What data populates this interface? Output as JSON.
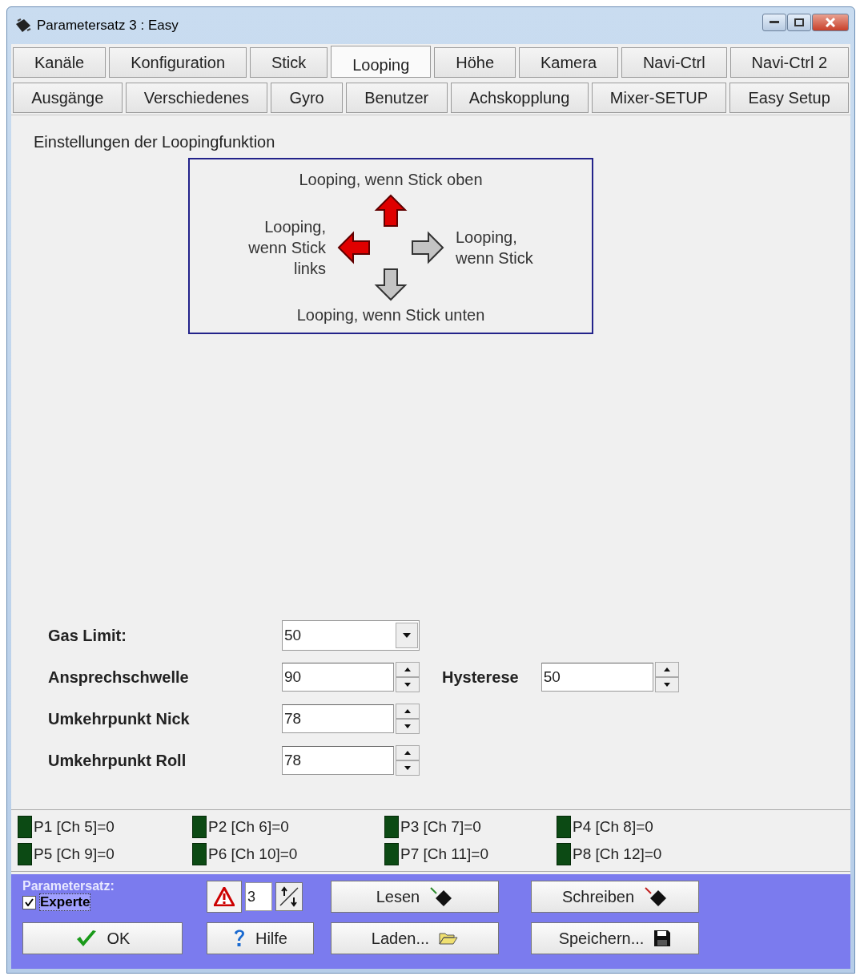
{
  "window": {
    "title": "Parametersatz 3 : Easy"
  },
  "tab_rows": [
    {
      "tabs": [
        {
          "label": "Kanäle",
          "selected": false
        },
        {
          "label": "Konfiguration",
          "selected": false
        },
        {
          "label": "Stick",
          "selected": false
        },
        {
          "label": "Looping",
          "selected": true
        },
        {
          "label": "Höhe",
          "selected": false
        },
        {
          "label": "Kamera",
          "selected": false
        },
        {
          "label": "Navi-Ctrl",
          "selected": false
        },
        {
          "label": "Navi-Ctrl 2",
          "selected": false
        }
      ]
    },
    {
      "tabs": [
        {
          "label": "Ausgänge",
          "selected": false
        },
        {
          "label": "Verschiedenes",
          "selected": false
        },
        {
          "label": "Gyro",
          "selected": false
        },
        {
          "label": "Benutzer",
          "selected": false
        },
        {
          "label": "Achskopplung",
          "selected": false
        },
        {
          "label": "Mixer-SETUP",
          "selected": false
        },
        {
          "label": "Easy Setup",
          "selected": false
        }
      ]
    }
  ],
  "section_title": "Einstellungen der Loopingfunktion",
  "looping": {
    "directions": [
      {
        "kind": "up",
        "label": "Looping, wenn Stick oben",
        "active": true
      },
      {
        "kind": "left",
        "label": "Looping, wenn Stick links",
        "active": true
      },
      {
        "kind": "right",
        "label": "Looping, wenn Stick",
        "active": false
      },
      {
        "kind": "down",
        "label": "Looping, wenn Stick unten",
        "active": false
      }
    ]
  },
  "fields": [
    {
      "kind": "dropdown",
      "label": "Gas Limit:",
      "value": "50"
    },
    {
      "kind": "spinner",
      "label": "Ansprechschwelle",
      "value": "90",
      "extra": {
        "label": "Hysterese",
        "value": "50"
      }
    },
    {
      "kind": "spinner",
      "label": "Umkehrpunkt Nick",
      "value": "78"
    },
    {
      "kind": "spinner",
      "label": "Umkehrpunkt Roll",
      "value": "78"
    }
  ],
  "channels": [
    {
      "label": "P1 [Ch 5]=0"
    },
    {
      "label": "P2 [Ch 6]=0"
    },
    {
      "label": "P3 [Ch 7]=0"
    },
    {
      "label": "P4 [Ch 8]=0"
    },
    {
      "label": "P5 [Ch 9]=0"
    },
    {
      "label": "P6 [Ch 10]=0"
    },
    {
      "label": "P7 [Ch 11]=0"
    },
    {
      "label": "P8 [Ch 12]=0"
    }
  ],
  "footer": {
    "group_label": "Parametersatz:",
    "expert": {
      "label": "Experte",
      "checked": true
    },
    "set_number": "3",
    "buttons": [
      {
        "kind": "read",
        "label": "Lesen"
      },
      {
        "kind": "write",
        "label": "Schreiben"
      },
      {
        "kind": "ok",
        "label": "OK"
      },
      {
        "kind": "help",
        "label": "Hilfe"
      },
      {
        "kind": "load",
        "label": "Laden..."
      },
      {
        "kind": "save",
        "label": "Speichern..."
      }
    ]
  }
}
